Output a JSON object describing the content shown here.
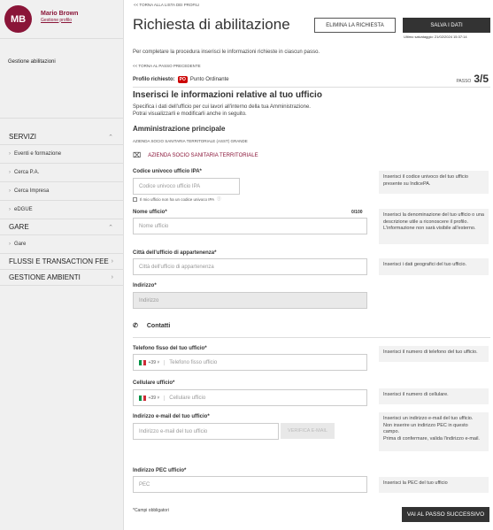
{
  "user": {
    "initials": "MB",
    "name": "Mario Brown",
    "profile_link": "Gestione profilo"
  },
  "sidebar": {
    "top_item": "Gestione abilitazioni",
    "groups": [
      {
        "label": "SERVIZI",
        "items": [
          "Eventi e formazione",
          "Cerca P.A.",
          "Cerca Impresa",
          "eDGUE"
        ]
      },
      {
        "label": "GARE",
        "items": [
          "Gare"
        ]
      },
      {
        "label": "FLUSSI E TRANSACTION FEE",
        "items": []
      },
      {
        "label": "GESTIONE AMBIENTI",
        "items": []
      }
    ]
  },
  "header": {
    "back_link": "<< TORNA ALLA LISTA DEI PROFILI",
    "title": "Richiesta di abilitazione",
    "delete_button": "ELIMINA LA RICHIESTA",
    "save_button": "SALVA I DATI",
    "last_save": "Ultimo salvataggio: 21/02/2024 15:37:14"
  },
  "intro": "Per completare la procedura inserisci le informazioni richieste in ciascun passo.",
  "back_prev": "<< TORNA AL PASSO PRECEDENTE",
  "profile": {
    "label": "Profilo richiesto:",
    "badge": "PO",
    "value": "Punto Ordinante"
  },
  "step": {
    "label": "PASSO",
    "value": "3/5"
  },
  "section": {
    "title": "Inserisci le informazioni relative al tuo ufficio",
    "desc1": "Specifica i dati dell'ufficio per cui lavori all'interno della tua Amministrazione.",
    "desc2": "Potrai visualizzarli e modificarli anche in seguito."
  },
  "admin": {
    "title": "Amministrazione principale",
    "subtitle": "AZIENDA SOCIO SANITARIA TERRITORIALE (ASST) GRANDE",
    "org": "AZIENDA SOCIO SANITARIA TERRITORIALE"
  },
  "fields": {
    "ipa": {
      "label": "Codice univoco ufficio IPA*",
      "placeholder": "Codice univoco ufficio IPA",
      "check": "Il mio ufficio non ha un codice univoco IPA",
      "help": "Inserisci il codice univoco del tuo ufficio presente su IndicePA."
    },
    "name": {
      "label": "Nome ufficio*",
      "counter": "0/100",
      "placeholder": "Nome ufficio",
      "help": "Inserisci la denominazione del tuo ufficio o una descrizione utile a riconoscere il profilo. L'informazione non sarà visibile all'esterno."
    },
    "city": {
      "label": "Città dell'ufficio di appartenenza*",
      "placeholder": "Città dell'ufficio di appartenenza",
      "help": "Inserisci i dati geografici del tuo ufficio."
    },
    "address": {
      "label": "Indirizzo*",
      "placeholder": "Indirizzo"
    },
    "contacts_title": "Contatti",
    "phone": {
      "label": "Telefono fisso del tuo ufficio*",
      "prefix": "+39",
      "placeholder": "Telefono fisso ufficio",
      "help": "Inserisci il numero di telefono del tuo ufficio."
    },
    "mobile": {
      "label": "Cellulare ufficio*",
      "prefix": "+39",
      "placeholder": "Cellulare ufficio",
      "help": "Inserisci il numero di cellulare."
    },
    "email": {
      "label": "Indirizzo e-mail del tuo ufficio*",
      "placeholder": "Indirizzo e-mail del tuo ufficio",
      "verify_button": "VERIFICA E-MAIL",
      "help1": "Inserisci un indirizzo e-mail del tuo ufficio.",
      "help2": "Non inserire un indirizzo PEC in questo campo.",
      "help3": "Prima di confermare, valida l'indirizzo e-mail."
    },
    "pec": {
      "label": "Indirizzo PEC ufficio*",
      "placeholder": "PEC",
      "help": "Inserisci la PEC del tuo ufficio"
    }
  },
  "footer": {
    "required": "*Campi obbligatori",
    "next_button": "VAI AL PASSO SUCCESSIVO"
  },
  "colors": {
    "brand": "#8a1538",
    "dark_button": "#333333",
    "badge": "#cc0000"
  }
}
